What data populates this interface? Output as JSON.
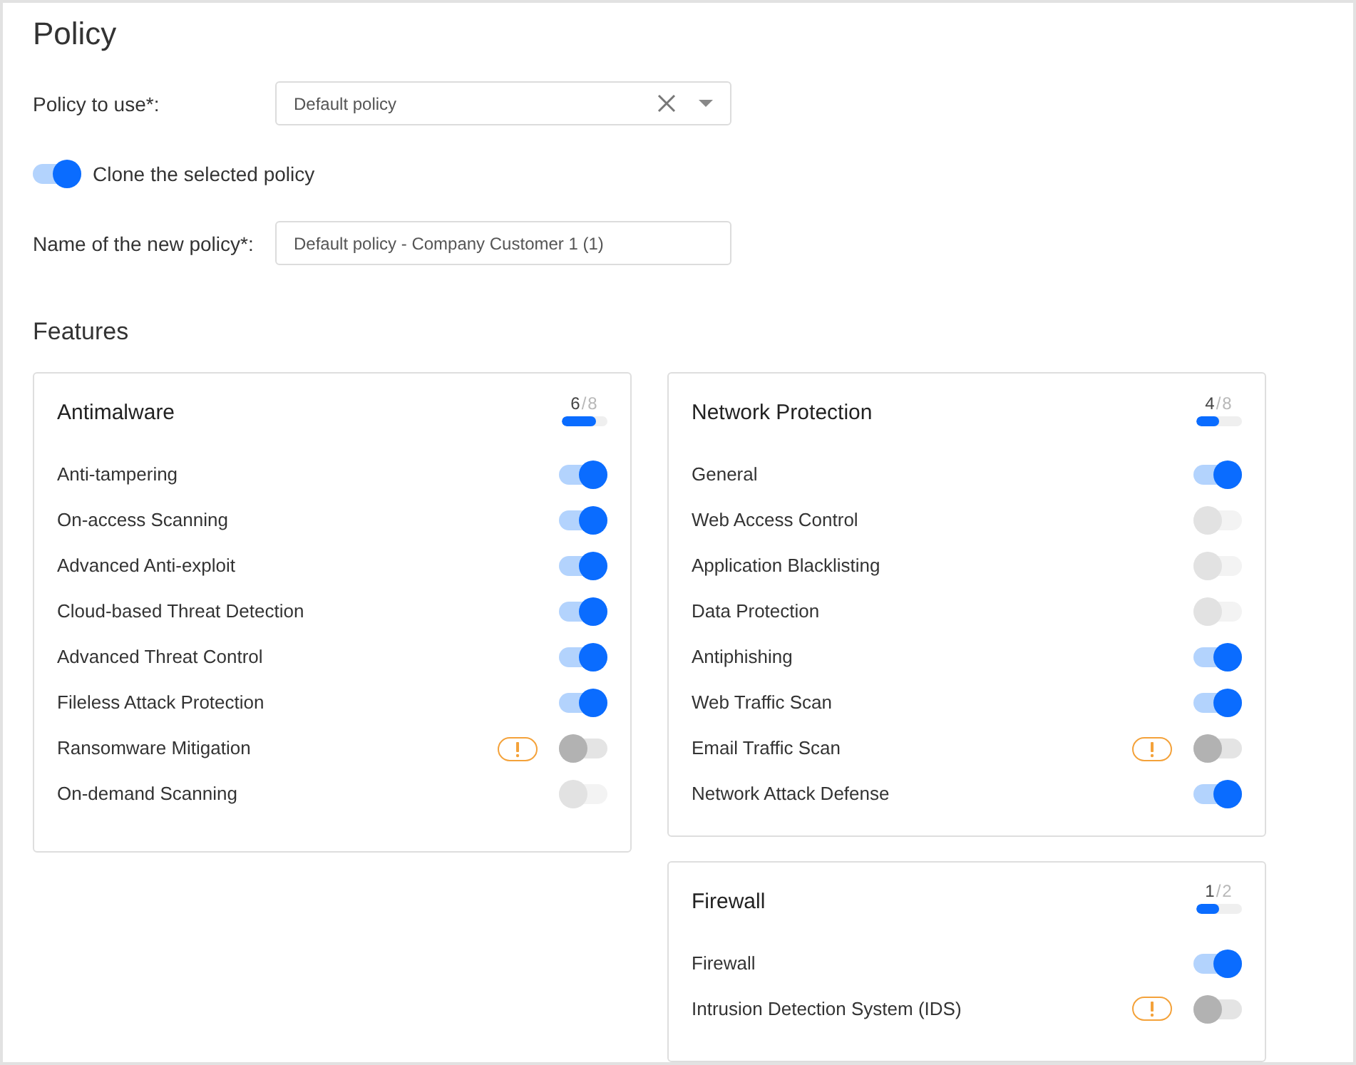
{
  "title": "Policy",
  "policy_select": {
    "label": "Policy to use*:",
    "value": "Default policy"
  },
  "clone_toggle": {
    "label": "Clone the selected policy",
    "on": true
  },
  "new_policy_name": {
    "label": "Name of the new policy*:",
    "value": "Default policy - Company Customer 1 (1)"
  },
  "features": {
    "heading": "Features",
    "columns": [
      {
        "cards": [
          {
            "title": "Antimalware",
            "count": "6",
            "total": "/8",
            "level": 0.75,
            "items": [
              {
                "label": "Anti-tampering",
                "on": true,
                "disabled": false,
                "warning": false
              },
              {
                "label": "On-access Scanning",
                "on": true,
                "disabled": false,
                "warning": false
              },
              {
                "label": "Advanced Anti-exploit",
                "on": true,
                "disabled": false,
                "warning": false
              },
              {
                "label": "Cloud-based Threat Detection",
                "on": true,
                "disabled": false,
                "warning": false
              },
              {
                "label": "Advanced Threat Control",
                "on": true,
                "disabled": false,
                "warning": false
              },
              {
                "label": "Fileless Attack Protection",
                "on": true,
                "disabled": false,
                "warning": false
              },
              {
                "label": "Ransomware Mitigation",
                "on": false,
                "disabled": false,
                "warning": true
              },
              {
                "label": "On-demand Scanning",
                "on": false,
                "disabled": true,
                "warning": false
              }
            ]
          }
        ]
      },
      {
        "cards": [
          {
            "title": "Network Protection",
            "count": "4",
            "total": "/8",
            "level": 0.5,
            "items": [
              {
                "label": "General",
                "on": true,
                "disabled": false,
                "warning": false
              },
              {
                "label": "Web Access Control",
                "on": false,
                "disabled": true,
                "warning": false
              },
              {
                "label": "Application Blacklisting",
                "on": false,
                "disabled": true,
                "warning": false
              },
              {
                "label": "Data Protection",
                "on": false,
                "disabled": true,
                "warning": false
              },
              {
                "label": "Antiphishing",
                "on": true,
                "disabled": false,
                "warning": false
              },
              {
                "label": "Web Traffic Scan",
                "on": true,
                "disabled": false,
                "warning": false
              },
              {
                "label": "Email Traffic Scan",
                "on": false,
                "disabled": false,
                "warning": true
              },
              {
                "label": "Network Attack Defense",
                "on": true,
                "disabled": false,
                "warning": false
              }
            ]
          },
          {
            "title": "Firewall",
            "count": "1",
            "total": "/2",
            "level": 0.5,
            "items": [
              {
                "label": "Firewall",
                "on": true,
                "disabled": false,
                "warning": false
              },
              {
                "label": "Intrusion Detection System (IDS)",
                "on": false,
                "disabled": false,
                "warning": true
              }
            ]
          }
        ]
      }
    ]
  }
}
